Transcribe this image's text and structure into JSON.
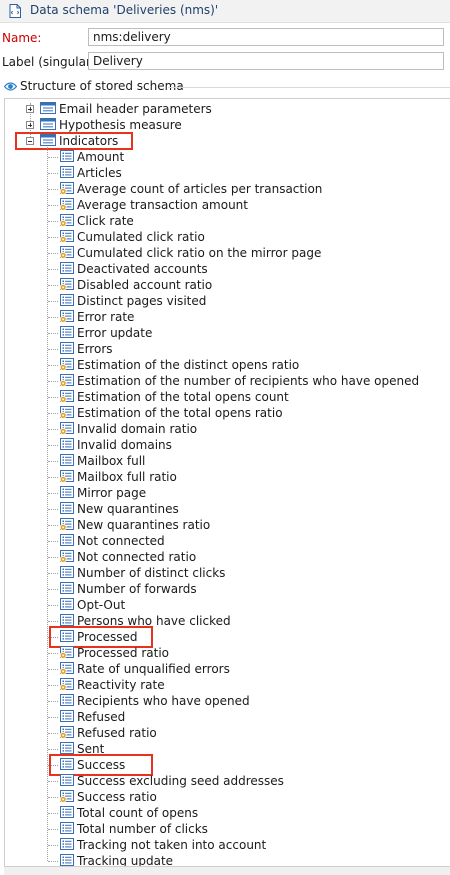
{
  "window": {
    "title": "Data schema 'Deliveries (nms)'"
  },
  "form": {
    "name_label": "Name:",
    "name_value": "nms:delivery",
    "label_label": "Label (singular):",
    "label_value": "Delivery"
  },
  "section": {
    "title": "Structure of stored schema"
  },
  "colors": {
    "name_label": "#cc0000",
    "highlight": "#e8321e",
    "attribute_icon": "#3a6fb5",
    "computed_badge": "#e8a317"
  },
  "tree": {
    "top_nodes": [
      {
        "label": "Email header parameters",
        "state": "collapsed"
      },
      {
        "label": "Hypothesis measure",
        "state": "collapsed"
      },
      {
        "label": "Indicators",
        "state": "expanded",
        "highlighted": true
      }
    ],
    "children": [
      {
        "label": "Amount",
        "icon": "attribute-icon"
      },
      {
        "label": "Articles",
        "icon": "attribute-icon"
      },
      {
        "label": "Average count of articles per transaction",
        "icon": "computed-attribute-icon"
      },
      {
        "label": "Average transaction amount",
        "icon": "computed-attribute-icon"
      },
      {
        "label": "Click rate",
        "icon": "computed-attribute-icon"
      },
      {
        "label": "Cumulated click ratio",
        "icon": "computed-attribute-icon"
      },
      {
        "label": "Cumulated click ratio on the mirror page",
        "icon": "computed-attribute-icon"
      },
      {
        "label": "Deactivated accounts",
        "icon": "attribute-icon"
      },
      {
        "label": "Disabled account ratio",
        "icon": "computed-attribute-icon"
      },
      {
        "label": "Distinct pages visited",
        "icon": "attribute-icon"
      },
      {
        "label": "Error rate",
        "icon": "computed-attribute-icon"
      },
      {
        "label": "Error update",
        "icon": "attribute-icon"
      },
      {
        "label": "Errors",
        "icon": "attribute-icon"
      },
      {
        "label": "Estimation of the distinct opens ratio",
        "icon": "computed-attribute-icon"
      },
      {
        "label": "Estimation of the number of recipients who have opened",
        "icon": "computed-attribute-icon"
      },
      {
        "label": "Estimation of the total opens count",
        "icon": "computed-attribute-icon"
      },
      {
        "label": "Estimation of the total opens ratio",
        "icon": "computed-attribute-icon"
      },
      {
        "label": "Invalid domain ratio",
        "icon": "computed-attribute-icon"
      },
      {
        "label": "Invalid domains",
        "icon": "attribute-icon"
      },
      {
        "label": "Mailbox full",
        "icon": "attribute-icon"
      },
      {
        "label": "Mailbox full ratio",
        "icon": "computed-attribute-icon"
      },
      {
        "label": "Mirror page",
        "icon": "attribute-icon"
      },
      {
        "label": "New quarantines",
        "icon": "attribute-icon"
      },
      {
        "label": "New quarantines ratio",
        "icon": "computed-attribute-icon"
      },
      {
        "label": "Not connected",
        "icon": "attribute-icon"
      },
      {
        "label": "Not connected ratio",
        "icon": "computed-attribute-icon"
      },
      {
        "label": "Number of distinct clicks",
        "icon": "attribute-icon"
      },
      {
        "label": "Number of forwards",
        "icon": "attribute-icon"
      },
      {
        "label": "Opt-Out",
        "icon": "attribute-icon"
      },
      {
        "label": "Persons who have clicked",
        "icon": "attribute-icon"
      },
      {
        "label": "Processed",
        "icon": "attribute-icon",
        "highlighted": true
      },
      {
        "label": "Processed ratio",
        "icon": "computed-attribute-icon"
      },
      {
        "label": "Rate of unqualified errors",
        "icon": "computed-attribute-icon"
      },
      {
        "label": "Reactivity rate",
        "icon": "computed-attribute-icon"
      },
      {
        "label": "Recipients who have opened",
        "icon": "attribute-icon"
      },
      {
        "label": "Refused",
        "icon": "attribute-icon"
      },
      {
        "label": "Refused ratio",
        "icon": "computed-attribute-icon"
      },
      {
        "label": "Sent",
        "icon": "attribute-icon"
      },
      {
        "label": "Success",
        "icon": "attribute-icon",
        "highlighted": true
      },
      {
        "label": "Success excluding seed addresses",
        "icon": "attribute-icon"
      },
      {
        "label": "Success ratio",
        "icon": "computed-attribute-icon"
      },
      {
        "label": "Total count of opens",
        "icon": "attribute-icon"
      },
      {
        "label": "Total number of clicks",
        "icon": "attribute-icon"
      },
      {
        "label": "Tracking not taken into account",
        "icon": "attribute-icon"
      },
      {
        "label": "Tracking update",
        "icon": "attribute-icon"
      }
    ]
  }
}
